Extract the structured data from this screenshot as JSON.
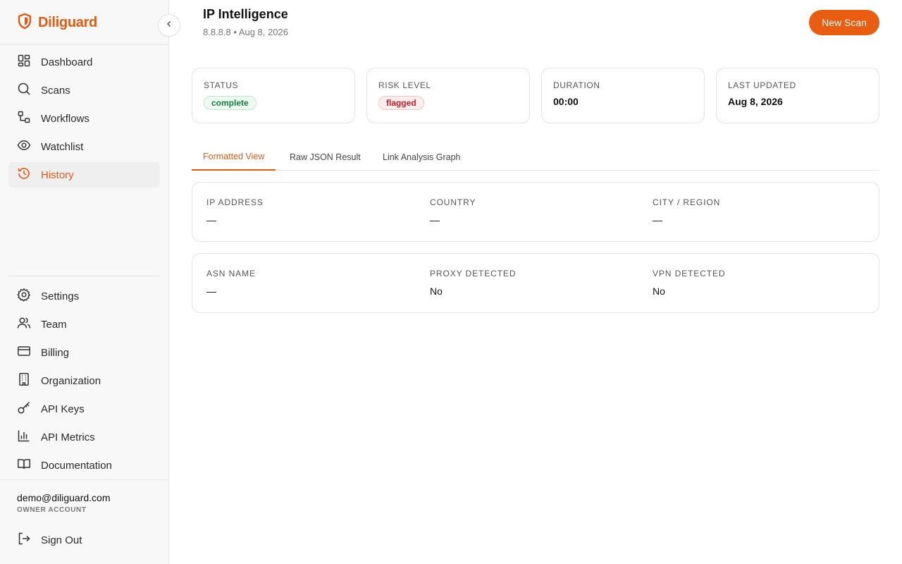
{
  "brand": {
    "name": "Diliguard",
    "accent": "#e35a10"
  },
  "sidebar": {
    "main_items": [
      {
        "label": "Dashboard",
        "icon": "dashboard-icon"
      },
      {
        "label": "Scans",
        "icon": "search-icon"
      },
      {
        "label": "Workflows",
        "icon": "workflow-icon"
      },
      {
        "label": "Watchlist",
        "icon": "eye-icon"
      },
      {
        "label": "History",
        "icon": "history-icon",
        "active": true
      }
    ],
    "bottom_items": [
      {
        "label": "Settings",
        "icon": "gear-icon"
      },
      {
        "label": "Team",
        "icon": "users-icon"
      },
      {
        "label": "Billing",
        "icon": "credit-card-icon"
      },
      {
        "label": "Organization",
        "icon": "building-icon"
      },
      {
        "label": "API Keys",
        "icon": "key-icon"
      },
      {
        "label": "API Metrics",
        "icon": "bar-chart-icon"
      },
      {
        "label": "Documentation",
        "icon": "book-icon"
      }
    ],
    "user": {
      "email": "demo@diliguard.com",
      "role": "OWNER ACCOUNT"
    },
    "sign_out": "Sign Out"
  },
  "header": {
    "title": "IP Intelligence",
    "subtitle": "8.8.8.8 • Aug 8, 2026",
    "new_scan": "New Scan"
  },
  "stats": {
    "status": {
      "label": "STATUS",
      "value": "complete"
    },
    "risk": {
      "label": "RISK LEVEL",
      "value": "flagged"
    },
    "duration": {
      "label": "DURATION",
      "value": "00:00"
    },
    "updated": {
      "label": "LAST UPDATED",
      "value": "Aug 8, 2026"
    }
  },
  "tabs": [
    "Formatted View",
    "Raw JSON Result",
    "Link Analysis Graph"
  ],
  "fields": {
    "ip": {
      "label": "IP ADDRESS",
      "value": "—"
    },
    "country": {
      "label": "COUNTRY",
      "value": "—"
    },
    "city": {
      "label": "CITY / REGION",
      "value": "—"
    },
    "asn": {
      "label": "ASN NAME",
      "value": "—"
    },
    "proxy": {
      "label": "PROXY DETECTED",
      "value": "No"
    },
    "vpn": {
      "label": "VPN DETECTED",
      "value": "No"
    }
  }
}
